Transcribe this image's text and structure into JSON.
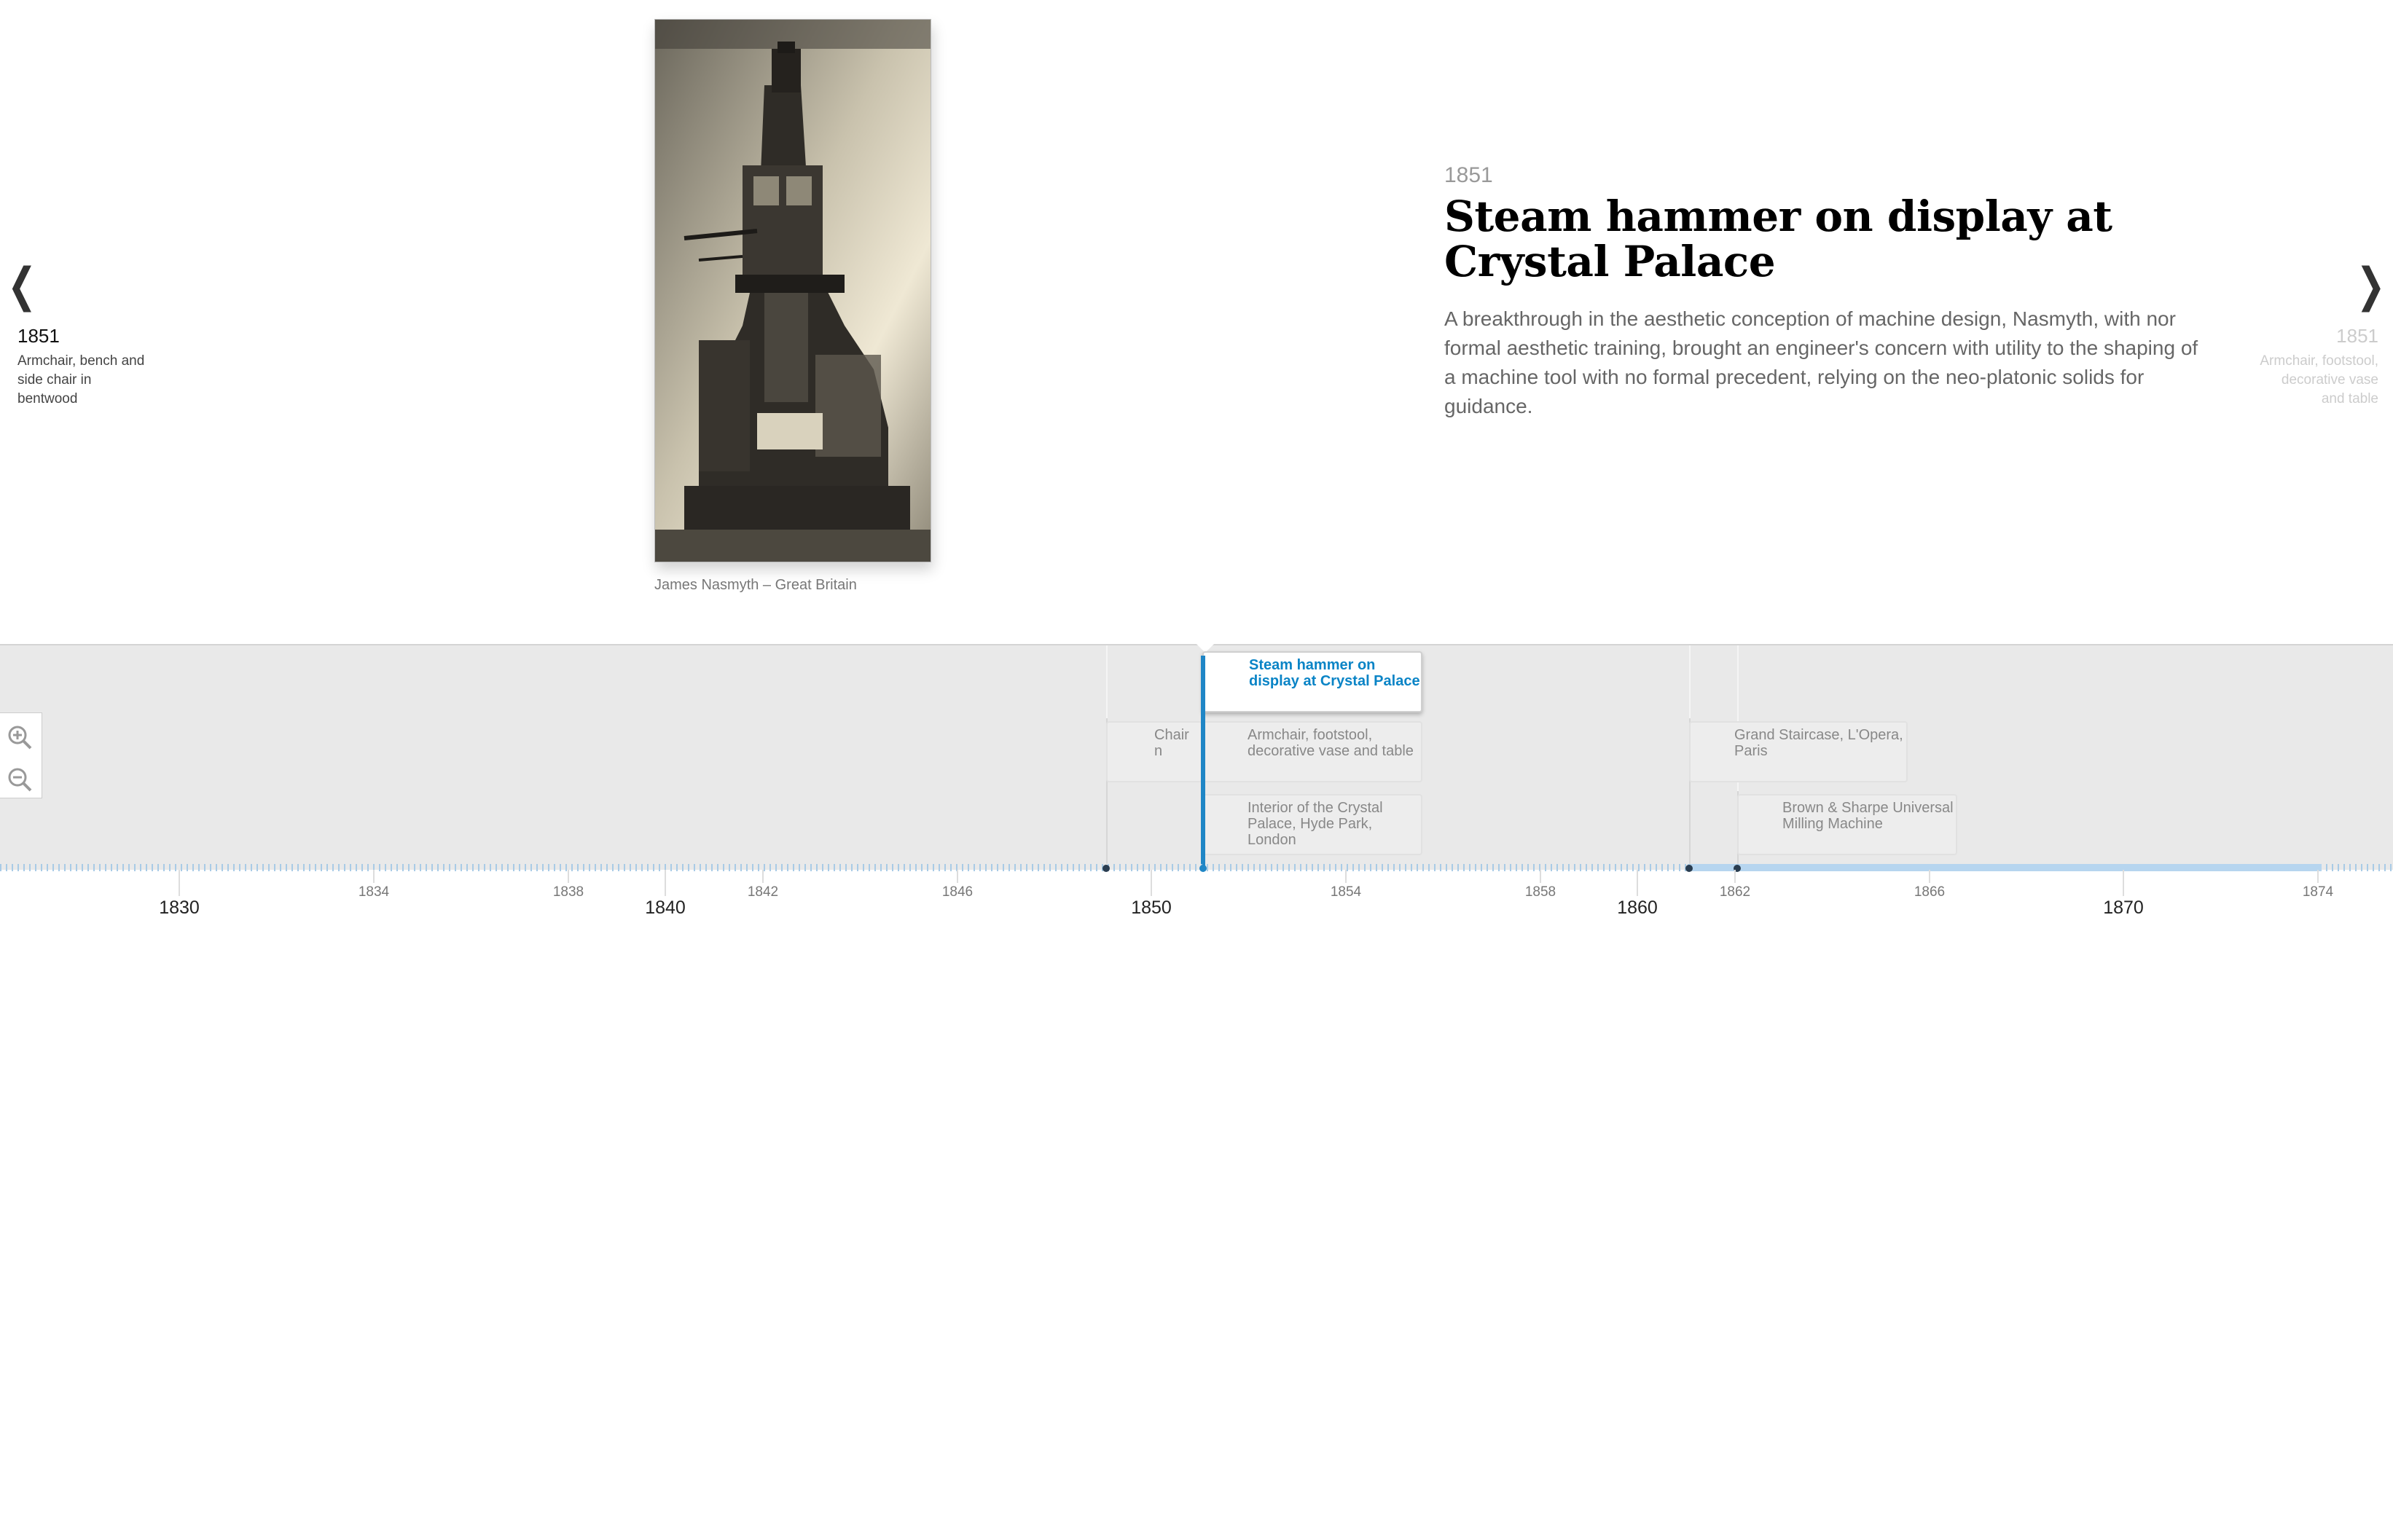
{
  "slide": {
    "date": "1851",
    "headline": "Steam hammer on display at Crystal Palace",
    "body": "A breakthrough in the aesthetic conception of machine design, Nasmyth, with nor formal aesthetic training, brought an engineer's concern with utility to the shaping of a machine tool with no formal precedent, relying on the neo-platonic solids for guidance.",
    "credit": "James Nasmyth – Great Britain"
  },
  "nav": {
    "prev_arrow": "❮",
    "next_arrow": "❯",
    "prev": {
      "date": "1851",
      "title": "Armchair, bench and side chair in bentwood"
    },
    "next": {
      "date": "1851",
      "title": "Armchair, footstool, decorative vase and table"
    }
  },
  "timeline": {
    "active_marker": "Steam hammer on display at Crystal Palace",
    "markers": [
      {
        "label": "Chair n"
      },
      {
        "label": "Armchair, footstool, decorative vase and table"
      },
      {
        "label": "Interior of the Crystal Palace, Hyde Park, London"
      },
      {
        "label": "Grand Staircase, L'Opera, Paris"
      },
      {
        "label": "Brown & Sharpe Universal Milling Machine"
      }
    ],
    "zoom_in_icon": "zoom-in-icon",
    "zoom_out_icon": "zoom-out-icon",
    "accent_color": "#1f86c6"
  },
  "axis": {
    "minor": [
      "1834",
      "1838",
      "1842",
      "1846",
      "1854",
      "1858",
      "1862",
      "1866",
      "1874"
    ],
    "major": [
      "1830",
      "1840",
      "1850",
      "1860",
      "1870"
    ]
  }
}
